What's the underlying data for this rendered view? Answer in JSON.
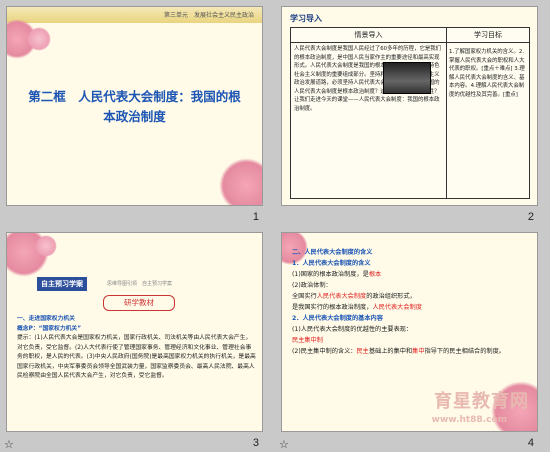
{
  "slides": [
    {
      "number": "1",
      "header": "第三单元　发展社会主义民主政治",
      "title_line1": "第二框　人民代表大会制度：我国的根",
      "title_line2": "本政治制度"
    },
    {
      "number": "2",
      "section": "学习导入",
      "table_head_left": "情景导入",
      "table_head_right": "学习目标",
      "left_text": "人民代表大会制度是我国人民经过了60多年的历程，它是我们的根本政治制度，是中国人民当家作主的重要途径和最高实现形式。人民代表大会制度是我国的根本政治制度，是中国特色社会主义制度的重要组成部分。坚持和完善中国特色社会主义政治发展道路，必须坚持人民代表大会制度。为什么说我国的人民代表大会制度是根本政治制度？这一制度有哪些优越性？让我们走进今天的课堂——人民代表大会制度：我国的根本政治制度。",
      "right_text": "1.了解国家权力机关的含义。2.掌握人民代表大会的职权和人大代表的职权。[重点＋难点] 3.理解人民代表大会制度的含义、基本内容。4.理解人民代表大会制度的优越性及其完善。[重点]"
    },
    {
      "number": "3",
      "tag": "自主预习学案",
      "tagline": "思维导图引领　自主预习学案",
      "banner": "研学教材",
      "h1": "一、走进国家权力机关",
      "h2": "概念P：“国家权力机关”",
      "body": "提示：(1)人民代表大会是国家权力机关，国家行政机关、司法机关等由人民代表大会产生，对它负责，受它监督。(2)人大代表行使了管理国家事务、管理经济和文化事业、管理社会事务的职权，是人民的代表。(3)中央人民政府(国务院)是最高国家权力机关的执行机关，是最高国家行政机关，中央军事委员会领导全国武装力量，国家监察委员会、最高人民法院、最高人民检察院由全国人民代表大会产生，对它负责，受它监督。"
    },
    {
      "number": "4",
      "h1": "二、人民代表大会制度的含义",
      "l1": "1．人民代表大会制度的含义",
      "l2a": "(1)国家的根本政治制度，是",
      "l2r": "根本",
      "l3": "(2)政治体制：",
      "l4a": "全国实行",
      "l4r": "人民代表大会制度",
      "l4b": "的政治组织形式，",
      "l5a": "是我国实行的根本政治制度，",
      "l5r": "人民代表大会制度",
      "h2": "2．人民代表大会制度的基本内容",
      "l6": "(1)人民代表大会制度的优越性的主要表现：",
      "l6r": "民主集中制",
      "l7a": "(2)民主集中制的含义：",
      "l7r1": "民主",
      "l7b": "基础上的集中和",
      "l7r2": "集中",
      "l7c": "指导下的民主相结合的制度。",
      "watermark": "育星教育网",
      "watermark_url": "www.ht88.com"
    }
  ]
}
